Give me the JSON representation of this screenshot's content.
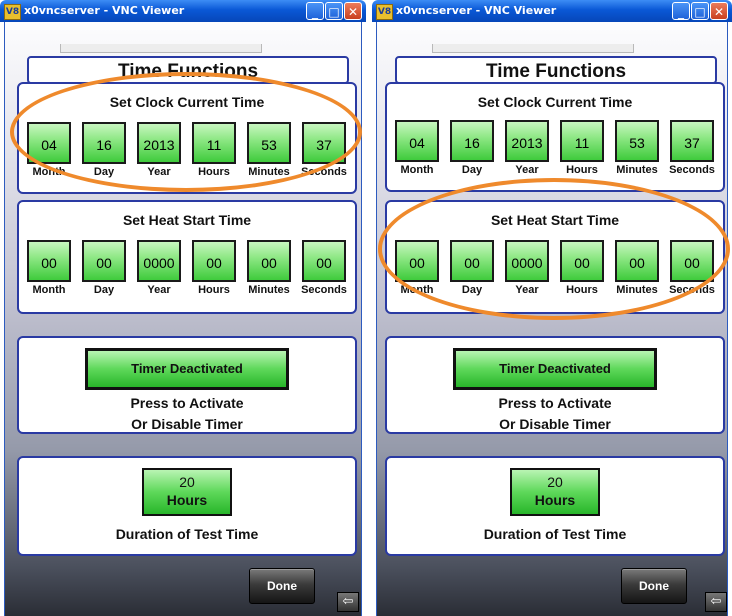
{
  "screens": [
    {
      "window_title": "x0vncserver - VNC Viewer",
      "app_icon": "V8",
      "page_title": "Time Functions",
      "clock_panel": {
        "title": "Set Clock Current Time",
        "fields": [
          {
            "value": "04",
            "label": "Month"
          },
          {
            "value": "16",
            "label": "Day"
          },
          {
            "value": "2013",
            "label": "Year"
          },
          {
            "value": "11",
            "label": "Hours"
          },
          {
            "value": "53",
            "label": "Minutes"
          },
          {
            "value": "37",
            "label": "Seconds"
          }
        ]
      },
      "heat_panel": {
        "title": "Set Heat Start Time",
        "fields": [
          {
            "value": "00",
            "label": "Month"
          },
          {
            "value": "00",
            "label": "Day"
          },
          {
            "value": "0000",
            "label": "Year"
          },
          {
            "value": "00",
            "label": "Hours"
          },
          {
            "value": "00",
            "label": "Minutes"
          },
          {
            "value": "00",
            "label": "Seconds"
          }
        ]
      },
      "timer_panel": {
        "button_label": "Timer Deactivated",
        "note_line1": "Press to Activate",
        "note_line2": "Or Disable Timer"
      },
      "duration_panel": {
        "value": "20",
        "unit": "Hours",
        "caption": "Duration of Test Time"
      },
      "done_label": "Done",
      "highlighted_panel": "clock"
    },
    {
      "window_title": "x0vncserver - VNC Viewer",
      "app_icon": "V8",
      "page_title": "Time Functions",
      "clock_panel": {
        "title": "Set Clock Current Time",
        "fields": [
          {
            "value": "04",
            "label": "Month"
          },
          {
            "value": "16",
            "label": "Day"
          },
          {
            "value": "2013",
            "label": "Year"
          },
          {
            "value": "11",
            "label": "Hours"
          },
          {
            "value": "53",
            "label": "Minutes"
          },
          {
            "value": "37",
            "label": "Seconds"
          }
        ]
      },
      "heat_panel": {
        "title": "Set Heat Start Time",
        "fields": [
          {
            "value": "00",
            "label": "Month"
          },
          {
            "value": "00",
            "label": "Day"
          },
          {
            "value": "0000",
            "label": "Year"
          },
          {
            "value": "00",
            "label": "Hours"
          },
          {
            "value": "00",
            "label": "Minutes"
          },
          {
            "value": "00",
            "label": "Seconds"
          }
        ]
      },
      "timer_panel": {
        "button_label": "Timer Deactivated",
        "note_line1": "Press to Activate",
        "note_line2": "Or Disable Timer"
      },
      "duration_panel": {
        "value": "20",
        "unit": "Hours",
        "caption": "Duration of Test Time"
      },
      "done_label": "Done",
      "highlighted_panel": "heat"
    }
  ],
  "icons": {
    "minimize": "minimize-icon",
    "maximize": "maximize-icon",
    "close": "close-icon",
    "back": "back-arrow-icon"
  },
  "colors": {
    "highlight": "#ef8a2c",
    "panel_border": "#2a3aa3",
    "button_green": "#5ed85a",
    "titlebar_blue": "#0a58d6"
  }
}
